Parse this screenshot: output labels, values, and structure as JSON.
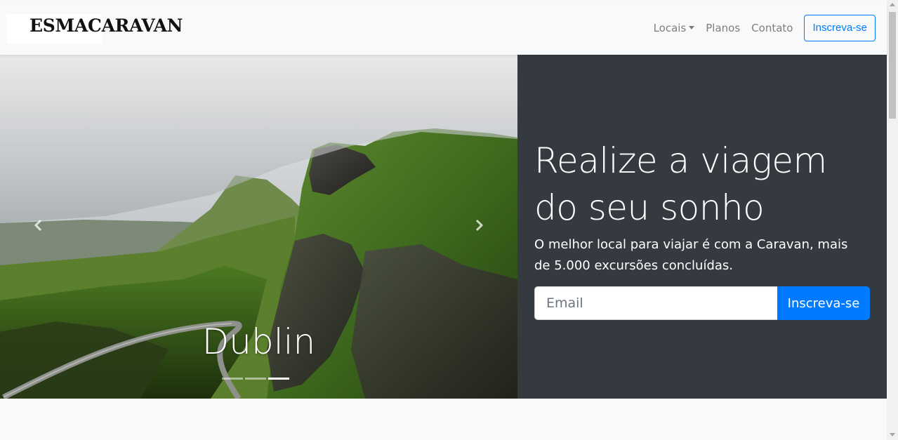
{
  "navbar": {
    "brand": "ESMACARAVAN",
    "links": [
      {
        "label": "Locais",
        "dropdown": true
      },
      {
        "label": "Planos"
      },
      {
        "label": "Contato"
      }
    ],
    "signup_button": "Inscreva-se"
  },
  "hero": {
    "caption": "Dublin",
    "slides_count": 3,
    "active_slide": 3,
    "prev_icon": "chevron-left-icon",
    "next_icon": "chevron-right-icon"
  },
  "panel": {
    "headline": "Realize a viagem do seu sonho",
    "subtitle": "O melhor local para viajar é com a Caravan, mais de 5.000 excursões concluídas.",
    "email_placeholder": "Email",
    "submit_label": "Inscreva-se"
  },
  "colors": {
    "primary": "#007bff",
    "dark_panel": "#343a40",
    "navbar_bg": "#f8f9fa"
  }
}
